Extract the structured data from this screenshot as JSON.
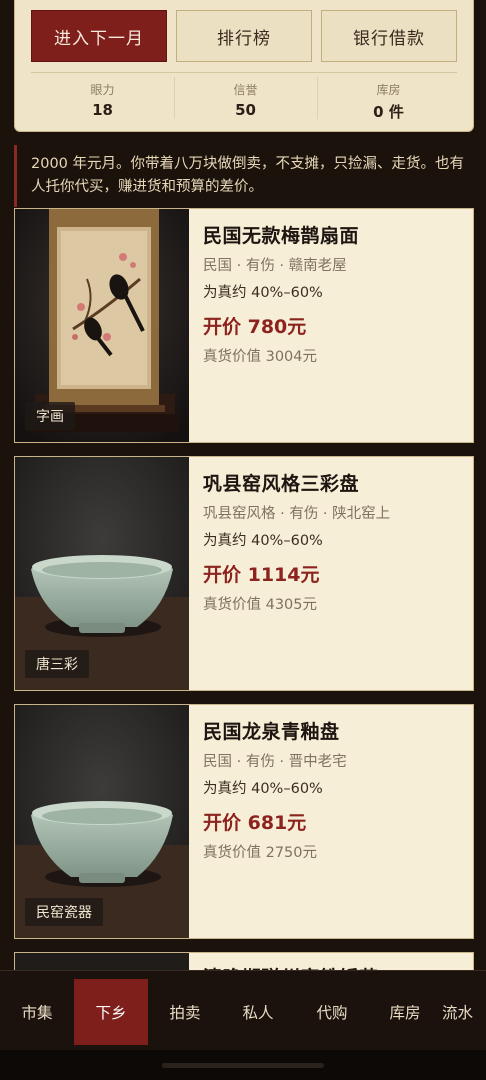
{
  "actions": {
    "next_month": "进入下一月",
    "leaderboard": "排行榜",
    "bank_loan": "银行借款"
  },
  "stats": [
    {
      "label": "眼力",
      "value": "18"
    },
    {
      "label": "信誉",
      "value": "50"
    },
    {
      "label": "库房",
      "value": "0 件"
    }
  ],
  "notice": "2000 年元月。你带着八万块做倒卖，不支摊，只捡漏、走货。也有人托你代买，赚进货和预算的差价。",
  "items": [
    {
      "title": "民国无款梅鹊扇面",
      "meta": "民国 · 有伤 · 赣南老屋",
      "odds": "为真约 40%–60%",
      "price": "开价 780元",
      "real_value": "真货价值 3004元",
      "category": "字画",
      "image": "hanging-scroll-magpie"
    },
    {
      "title": "巩县窑风格三彩盘",
      "meta": "巩县窑风格 · 有伤 · 陕北窑上",
      "odds": "为真约 40%–60%",
      "price": "开价 1114元",
      "real_value": "真货价值 4305元",
      "category": "唐三彩",
      "image": "celadon-bowl"
    },
    {
      "title": "民国龙泉青釉盘",
      "meta": "民国 · 有伤 · 晋中老宅",
      "odds": "为真约 40%–60%",
      "price": "开价 681元",
      "real_value": "真货价值 2750元",
      "category": "民窑瓷器",
      "image": "celadon-bowl"
    }
  ],
  "partial_card_title": "清晚期磁州窑铁锈花",
  "nav": [
    {
      "label": "市集",
      "active": false
    },
    {
      "label": "下乡",
      "active": true
    },
    {
      "label": "拍卖",
      "active": false
    },
    {
      "label": "私人",
      "active": false
    },
    {
      "label": "代购",
      "active": false
    },
    {
      "label": "库房",
      "active": false
    },
    {
      "label": "流水",
      "active": false
    }
  ],
  "colors": {
    "accent": "#7e1f1c",
    "price": "#8c231e",
    "panel": "#efe4c7",
    "background": "#1c120c"
  }
}
